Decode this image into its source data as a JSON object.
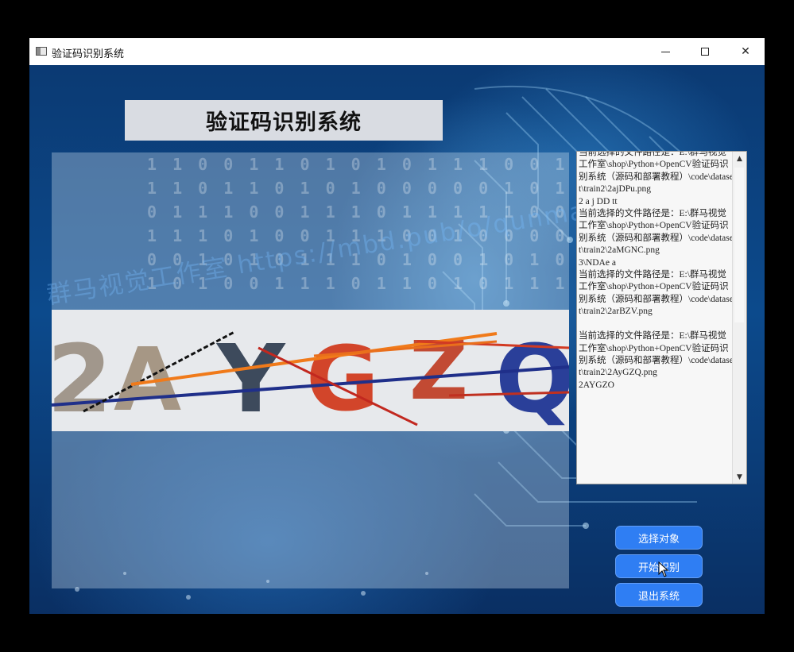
{
  "window": {
    "title": "验证码识别系统",
    "controls": {
      "minimize": "",
      "maximize": "",
      "close": "✕"
    }
  },
  "app": {
    "heading": "验证码识别系统"
  },
  "captcha_image": {
    "text": "2AYGZQ"
  },
  "log": {
    "text": "当前选择的文件路径是：E:\\群马视觉工作室\\shop\\Python+OpenCV验证码识别系统（源码和部署教程）\\code\\dataset\\train2\\2ajDPu.png\n2 a j DD tt\n当前选择的文件路径是：E:\\群马视觉工作室\\shop\\Python+OpenCV验证码识别系统（源码和部署教程）\\code\\dataset\\train2\\2aMGNC.png\n3\\NDAe a\n当前选择的文件路径是：E:\\群马视觉工作室\\shop\\Python+OpenCV验证码识别系统（源码和部署教程）\\code\\dataset\\train2\\2arBZV.png\n\n当前选择的文件路径是：E:\\群马视觉工作室\\shop\\Python+OpenCV验证码识别系统（源码和部署教程）\\code\\dataset\\train2\\2AyGZQ.png\n2AYGZO"
  },
  "buttons": {
    "select": "选择对象",
    "start": "开始识别",
    "exit": "退出系统"
  },
  "watermark": "群马视觉工作室 https://mbd.pub/o/qunma/work",
  "colors": {
    "button": "#2f7ef3",
    "captcha_red": "#d2452a",
    "captcha_blue": "#2a3f99",
    "captcha_dark": "#3d4a5c"
  }
}
